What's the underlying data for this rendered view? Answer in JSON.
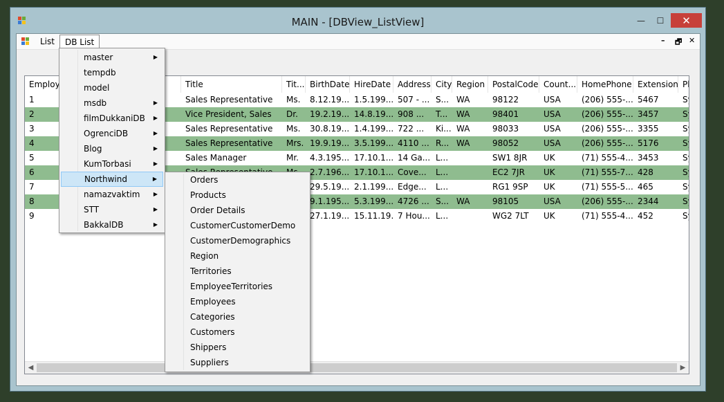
{
  "window": {
    "title": "MAIN - [DBView_ListView]",
    "minimize": "—",
    "maximize": "☐",
    "close": "✕"
  },
  "menubar": {
    "items": [
      "List",
      "DB List"
    ],
    "mdi_controls": [
      "–",
      "🗗",
      "✕"
    ]
  },
  "listview": {
    "columns": [
      "Employe",
      "me",
      "Title",
      "Tit...",
      "BirthDate",
      "HireDate",
      "Address",
      "City",
      "Region",
      "PostalCode",
      "Count...",
      "HomePhone",
      "Extension",
      "Ph"
    ],
    "rows": [
      [
        "1",
        "",
        "Sales Representative",
        "Ms.",
        "8.12.19...",
        "1.5.199...",
        "507 - ...",
        "S...",
        "WA",
        "98122",
        "USA",
        "(206) 555-...",
        "5467",
        "Sy"
      ],
      [
        "2",
        "",
        "Vice President, Sales",
        "Dr.",
        "19.2.19...",
        "14.8.19...",
        "908 ...",
        "T...",
        "WA",
        "98401",
        "USA",
        "(206) 555-...",
        "3457",
        "Sy"
      ],
      [
        "3",
        "",
        "Sales Representative",
        "Ms.",
        "30.8.19...",
        "1.4.199...",
        "722 ...",
        "Ki...",
        "WA",
        "98033",
        "USA",
        "(206) 555-...",
        "3355",
        "Sy"
      ],
      [
        "4",
        "et",
        "Sales Representative",
        "Mrs.",
        "19.9.19...",
        "3.5.199...",
        "4110 ...",
        "R...",
        "WA",
        "98052",
        "USA",
        "(206) 555-...",
        "5176",
        "Sy"
      ],
      [
        "5",
        "",
        "Sales Manager",
        "Mr.",
        "4.3.195...",
        "17.10.1...",
        "14 Ga...",
        "L...",
        "",
        "SW1 8JR",
        "UK",
        "(71) 555-4...",
        "3453",
        "Sy"
      ],
      [
        "6",
        "",
        "Sales Representative",
        "Ms.",
        "2.7.196...",
        "17.10.1...",
        "Cove...",
        "L...",
        "",
        "EC2 7JR",
        "UK",
        "(71) 555-7...",
        "428",
        "Sy"
      ],
      [
        "7",
        "",
        "",
        "",
        "29.5.19...",
        "2.1.199...",
        "Edge...",
        "L...",
        "",
        "RG1 9SP",
        "UK",
        "(71) 555-5...",
        "465",
        "Sy"
      ],
      [
        "8",
        "",
        "",
        "",
        "9.1.195...",
        "5.3.199...",
        "4726 ...",
        "S...",
        "WA",
        "98105",
        "USA",
        "(206) 555-...",
        "2344",
        "Sy"
      ],
      [
        "9",
        "",
        "",
        "",
        "27.1.19...",
        "15.11.19...",
        "7 Hou...",
        "L...",
        "",
        "WG2 7LT",
        "UK",
        "(71) 555-4...",
        "452",
        "Sy"
      ]
    ],
    "alt_row_color": "#8fbc8f"
  },
  "dropdown": {
    "items": [
      {
        "label": "master",
        "submenu": true
      },
      {
        "label": "tempdb",
        "submenu": false
      },
      {
        "label": "model",
        "submenu": false
      },
      {
        "label": "msdb",
        "submenu": true
      },
      {
        "label": "filmDukkaniDB",
        "submenu": true
      },
      {
        "label": "OgrenciDB",
        "submenu": true
      },
      {
        "label": "Blog",
        "submenu": true
      },
      {
        "label": "KumTorbasi",
        "submenu": true
      },
      {
        "label": "Northwind",
        "submenu": true
      },
      {
        "label": "namazvaktim",
        "submenu": true
      },
      {
        "label": "STT",
        "submenu": true
      },
      {
        "label": "BakkalDB",
        "submenu": true
      }
    ],
    "hovered": "Northwind"
  },
  "submenu": {
    "items": [
      "Orders",
      "Products",
      "Order Details",
      "CustomerCustomerDemo",
      "CustomerDemographics",
      "Region",
      "Territories",
      "EmployeeTerritories",
      "Employees",
      "Categories",
      "Customers",
      "Shippers",
      "Suppliers"
    ]
  },
  "icons": {
    "app": "app-windows-icon",
    "arrow": "chevron-right-icon"
  },
  "colors": {
    "window_frame": "#a9c4ce",
    "close_button": "#c7403a",
    "hover": "#cde6f7"
  }
}
